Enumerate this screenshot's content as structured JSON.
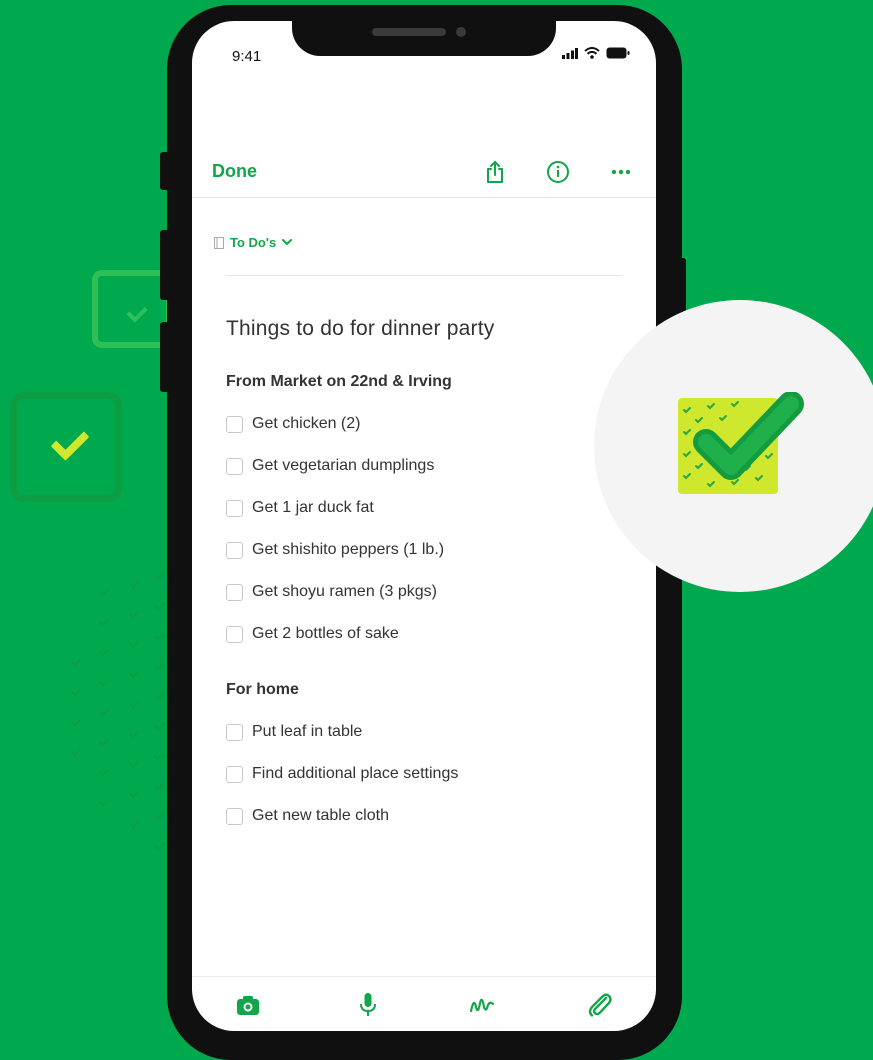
{
  "status_bar": {
    "time": "9:41"
  },
  "toolbar": {
    "done_label": "Done",
    "share_icon": "share-icon",
    "info_icon": "info-icon",
    "more_icon": "more-icon"
  },
  "notebook": {
    "name": "To Do's"
  },
  "note": {
    "title": "Things to do for dinner party",
    "sections": [
      {
        "heading": "From Market on 22nd & Irving",
        "items": [
          "Get chicken (2)",
          "Get vegetarian dumplings",
          "Get 1 jar duck fat",
          "Get shishito peppers (1 lb.)",
          "Get shoyu ramen (3 pkgs)",
          "Get 2 bottles of sake"
        ]
      },
      {
        "heading": "For home",
        "items": [
          "Put leaf in table",
          "Find additional place settings",
          "Get new table cloth"
        ]
      }
    ]
  },
  "bottom_bar": [
    "camera-icon",
    "microphone-icon",
    "handwriting-icon",
    "paperclip-icon"
  ],
  "colors": {
    "accent": "#13a54b",
    "background": "#00a94e",
    "highlight": "#cfe72c"
  }
}
